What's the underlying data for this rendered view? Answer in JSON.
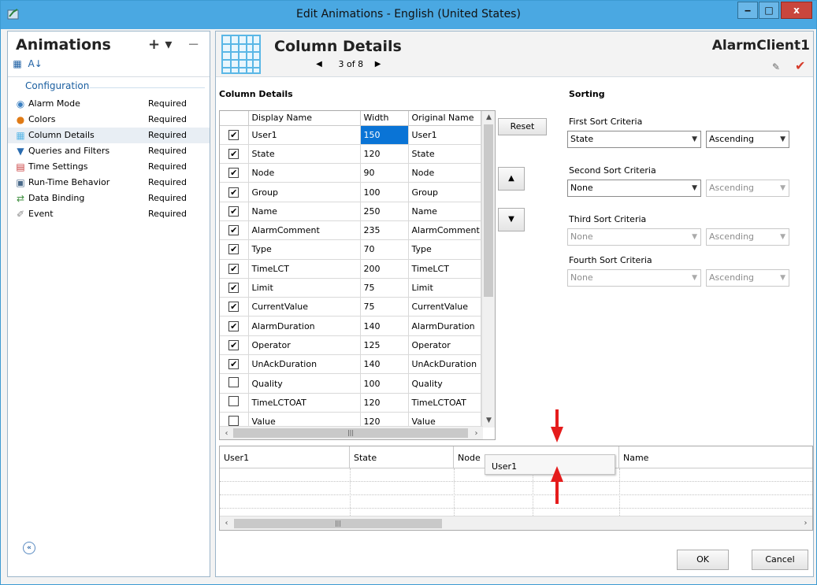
{
  "window": {
    "title": "Edit Animations - English (United States)",
    "controls": {
      "minimize": "‒",
      "maximize": "□",
      "close": "x"
    }
  },
  "left_pane": {
    "title": "Animations",
    "add_label": "+ ▾",
    "remove_label": "−",
    "group_label": "Configuration",
    "items": [
      {
        "name": "Alarm Mode",
        "status": "Required",
        "icon": "alarm-mode-icon",
        "color": "#3a7fc1"
      },
      {
        "name": "Colors",
        "status": "Required",
        "icon": "colors-icon",
        "color": "#e07b16"
      },
      {
        "name": "Column Details",
        "status": "Required",
        "icon": "column-details-icon",
        "color": "#5ab7e6"
      },
      {
        "name": "Queries and Filters",
        "status": "Required",
        "icon": "filter-icon",
        "color": "#2b6cb0"
      },
      {
        "name": "Time Settings",
        "status": "Required",
        "icon": "time-settings-icon",
        "color": "#c83a3a"
      },
      {
        "name": "Run-Time Behavior",
        "status": "Required",
        "icon": "runtime-behavior-icon",
        "color": "#4a6a8a"
      },
      {
        "name": "Data Binding",
        "status": "Required",
        "icon": "data-binding-icon",
        "color": "#3f8f3f"
      },
      {
        "name": "Event",
        "status": "Required",
        "icon": "event-icon",
        "color": "#8a8a8a"
      }
    ],
    "selected_index": 2
  },
  "header": {
    "title": "Column Details",
    "pager": "3 of 8",
    "client_name": "AlarmClient1"
  },
  "column_details": {
    "section_title": "Column Details",
    "headers": {
      "display": "Display Name",
      "width": "Width",
      "original": "Original Name"
    },
    "rows": [
      {
        "checked": true,
        "display": "User1",
        "width": "150",
        "original": "User1",
        "selected": true
      },
      {
        "checked": true,
        "display": "State",
        "width": "120",
        "original": "State"
      },
      {
        "checked": true,
        "display": "Node",
        "width": "90",
        "original": "Node"
      },
      {
        "checked": true,
        "display": "Group",
        "width": "100",
        "original": "Group"
      },
      {
        "checked": true,
        "display": "Name",
        "width": "250",
        "original": "Name"
      },
      {
        "checked": true,
        "display": "AlarmComment",
        "width": "235",
        "original": "AlarmComment"
      },
      {
        "checked": true,
        "display": "Type",
        "width": "70",
        "original": "Type"
      },
      {
        "checked": true,
        "display": "TimeLCT",
        "width": "200",
        "original": "TimeLCT"
      },
      {
        "checked": true,
        "display": "Limit",
        "width": "75",
        "original": "Limit"
      },
      {
        "checked": true,
        "display": "CurrentValue",
        "width": "75",
        "original": "CurrentValue"
      },
      {
        "checked": true,
        "display": "AlarmDuration",
        "width": "140",
        "original": "AlarmDuration"
      },
      {
        "checked": true,
        "display": "Operator",
        "width": "125",
        "original": "Operator"
      },
      {
        "checked": true,
        "display": "UnAckDuration",
        "width": "140",
        "original": "UnAckDuration"
      },
      {
        "checked": false,
        "display": "Quality",
        "width": "100",
        "original": "Quality"
      },
      {
        "checked": false,
        "display": "TimeLCTOAT",
        "width": "120",
        "original": "TimeLCTOAT"
      },
      {
        "checked": false,
        "display": "Value",
        "width": "120",
        "original": "Value"
      }
    ],
    "reset_label": "Reset",
    "move_up_label": "▲",
    "move_down_label": "▼"
  },
  "sorting": {
    "title": "Sorting",
    "criteria": [
      {
        "label": "First Sort Criteria",
        "field": "State",
        "order": "Ascending",
        "enabled": true,
        "order_enabled": true
      },
      {
        "label": "Second Sort Criteria",
        "field": "None",
        "order": "Ascending",
        "enabled": true,
        "order_enabled": false
      },
      {
        "label": "Third Sort Criteria",
        "field": "None",
        "order": "Ascending",
        "enabled": false,
        "order_enabled": false
      },
      {
        "label": "Fourth Sort Criteria",
        "field": "None",
        "order": "Ascending",
        "enabled": false,
        "order_enabled": false
      }
    ]
  },
  "preview": {
    "columns": [
      "User1",
      "State",
      "Node",
      "Name"
    ],
    "drag_ghost": "User1"
  },
  "footer": {
    "ok_label": "OK",
    "cancel_label": "Cancel"
  },
  "colors": {
    "title_bar": "#4aa8e2",
    "selection": "#0a74d6",
    "annotation_arrow": "#e51c1c"
  }
}
